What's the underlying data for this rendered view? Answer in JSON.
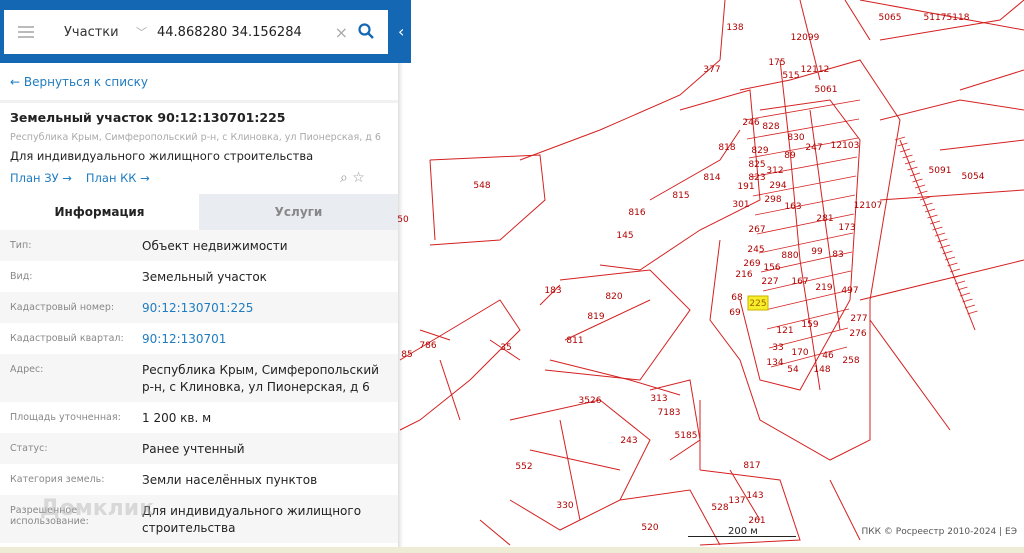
{
  "search": {
    "layer": "Участки",
    "query": "44.868280 34.156284"
  },
  "back_link": "← Вернуться к списку",
  "object": {
    "title": "Земельный участок 90:12:130701:225",
    "address": "Республика Крым, Симферопольский р-н, с Клиновка, ул Пионерская, д 6",
    "use": "Для индивидуального жилищного строительства",
    "plan_zu": "План ЗУ →",
    "plan_kk": "План КК →"
  },
  "tabs": [
    "Информация",
    "Услуги"
  ],
  "rows": [
    {
      "k": "Тип:",
      "v": "Объект недвижимости"
    },
    {
      "k": "Вид:",
      "v": "Земельный участок"
    },
    {
      "k": "Кадастровый номер:",
      "v": "90:12:130701:225"
    },
    {
      "k": "Кадастровый квартал:",
      "v": "90:12:130701"
    },
    {
      "k": "Адрес:",
      "v": "Республика Крым, Симферопольский р-н, с Клиновка, ул Пионерская, д 6"
    },
    {
      "k": "Площадь уточненная:",
      "v": "1 200 кв. м"
    },
    {
      "k": "Статус:",
      "v": "Ранее учтенный"
    },
    {
      "k": "Категория земель:",
      "v": "Земли населённых пунктов"
    },
    {
      "k": "Разрешенное использование:",
      "v": "Для индивидуального жилищного строительства"
    }
  ],
  "watermark": "Домклик",
  "map": {
    "scale": "200 м",
    "copyright": "ПКК © Росреестр 2010-2024 | ЕЭ",
    "highlight_color": "#f7ee2a",
    "line_color": "#d42020",
    "parcels": [
      "548",
      "818",
      "814",
      "815",
      "820",
      "819",
      "811",
      "225",
      "68",
      "69",
      "216",
      "245",
      "267",
      "301",
      "191",
      "312",
      "294",
      "298",
      "163",
      "281",
      "173",
      "99",
      "83",
      "219",
      "167",
      "227",
      "156",
      "269",
      "121",
      "159",
      "33",
      "170",
      "134",
      "54",
      "46",
      "148",
      "258",
      "276",
      "277",
      "5054",
      "5065",
      "5117",
      "5118",
      "12099",
      "138",
      "377",
      "175",
      "515",
      "5061",
      "12112",
      "246",
      "828",
      "829",
      "830",
      "247",
      "89",
      "825",
      "823",
      "12103",
      "12107",
      "5091",
      "880",
      "497",
      "817",
      "3526",
      "313",
      "243",
      "552",
      "330",
      "528",
      "137",
      "143",
      "261",
      "520",
      "85",
      "786",
      "35",
      "183",
      "145",
      "816",
      "5185",
      "7183",
      "50"
    ]
  }
}
